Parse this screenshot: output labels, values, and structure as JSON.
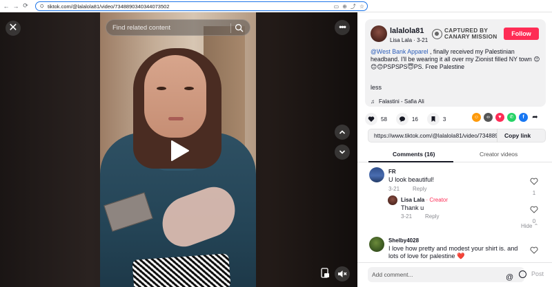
{
  "browser": {
    "url": "tiktok.com/@lalalola81/video/7348890340344073502",
    "back_icon": "back-arrow-icon",
    "forward_icon": "forward-arrow-icon",
    "reload_icon": "reload-icon"
  },
  "video": {
    "search_placeholder": "Find related content",
    "close_label": "✕",
    "more_label": "•••"
  },
  "author": {
    "username": "lalalola81",
    "nickname_line": "Lisa Lala · 3-21",
    "follow_label": "Follow",
    "watermark_line1": "CAPTURED BY",
    "watermark_line2": "CANARY MISSION"
  },
  "description": {
    "mention": "@West Bank Apparel",
    "text": " , finally received my Palestinian headband. I'll be wearing it all over my Zionist filled NY town 😊😊😊PSPSPS😇PS. Free Palestine",
    "less_label": "less",
    "music": "Falastini - Safia Ali"
  },
  "stats": {
    "likes": "58",
    "comments": "16",
    "saves": "3"
  },
  "share": {
    "link": "https://www.tiktok.com/@lalalola81/video/73488903...",
    "copy_label": "Copy link",
    "colors": [
      "#fe9a0b",
      "#555555",
      "#fe2c55",
      "#25d366",
      "#1877f2"
    ]
  },
  "tabs": {
    "comments": "Comments (16)",
    "creator_videos": "Creator videos"
  },
  "comments": [
    {
      "name": "FR",
      "text": "U look beautiful!",
      "date": "3-21",
      "reply": "Reply",
      "likes": "1"
    },
    {
      "name": "Lisa Lala",
      "badge": " · Creator",
      "text": "Thank u",
      "date": "3-21",
      "reply": "Reply",
      "likes": "0"
    },
    {
      "name": "Shelby4028",
      "text": "I love how pretty and modest your shirt is. and lots of love for palestine ❤️",
      "likes": ""
    }
  ],
  "hide_label": "Hide ⌃",
  "composer": {
    "placeholder": "Add comment...",
    "at_label": "@",
    "post_label": "Post"
  }
}
